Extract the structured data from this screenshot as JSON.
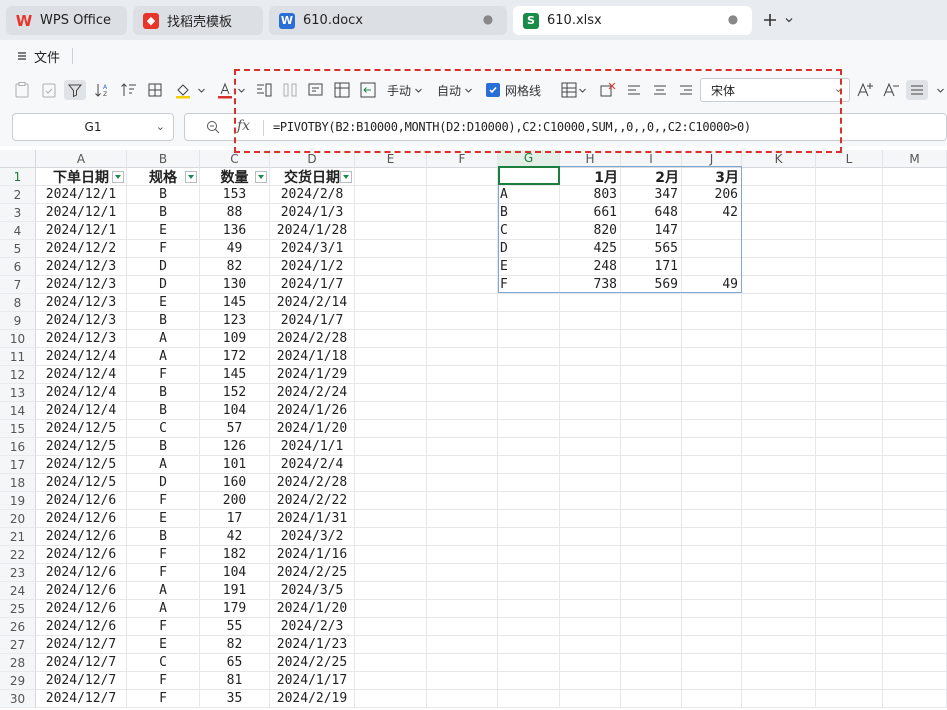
{
  "tabs": [
    {
      "label": "WPS Office",
      "icon": "wps-logo-icon",
      "color": "#e8352c"
    },
    {
      "label": "找稻壳模板",
      "icon": "docer-icon",
      "color": "#e8352c"
    },
    {
      "label": "610.docx",
      "icon": "word-doc-icon",
      "color": "#2b6fd6"
    },
    {
      "label": "610.xlsx",
      "icon": "spreadsheet-icon",
      "color": "#1a8a48"
    }
  ],
  "menu": {
    "file_label": "文件"
  },
  "toolbar": {
    "manual_label": "手动",
    "auto_label": "自动",
    "gridlines_label": "网格线",
    "gridlines_checked": true,
    "font_name": "宋体",
    "font_color": "#d9302c"
  },
  "formula_bar": {
    "cell_ref": "G1",
    "formula": "=PIVOTBY(B2:B10000,MONTH(D2:D10000),C2:C10000,SUM,,0,,0,,C2:C10000>0)"
  },
  "sheet": {
    "columns": [
      "A",
      "B",
      "C",
      "D",
      "E",
      "F",
      "G",
      "H",
      "I",
      "J",
      "K",
      "L",
      "M"
    ],
    "selected_column": "G",
    "selected_row": "1",
    "row_numbers": [
      "1",
      "2",
      "3",
      "4",
      "5",
      "6",
      "7",
      "8",
      "9",
      "10",
      "11",
      "12",
      "13",
      "14",
      "15",
      "16",
      "17",
      "18",
      "19",
      "20",
      "21",
      "22",
      "23",
      "24",
      "25",
      "26",
      "27",
      "28",
      "29",
      "30"
    ],
    "headers": {
      "a": "下单日期",
      "b": "规格",
      "c": "数量",
      "d": "交货日期"
    },
    "rows": [
      [
        "2024/12/1",
        "B",
        "153",
        "2024/2/8"
      ],
      [
        "2024/12/1",
        "B",
        "88",
        "2024/1/3"
      ],
      [
        "2024/12/1",
        "E",
        "136",
        "2024/1/28"
      ],
      [
        "2024/12/2",
        "F",
        "49",
        "2024/3/1"
      ],
      [
        "2024/12/3",
        "D",
        "82",
        "2024/1/2"
      ],
      [
        "2024/12/3",
        "D",
        "130",
        "2024/1/7"
      ],
      [
        "2024/12/3",
        "E",
        "145",
        "2024/2/14"
      ],
      [
        "2024/12/3",
        "B",
        "123",
        "2024/1/7"
      ],
      [
        "2024/12/3",
        "A",
        "109",
        "2024/2/28"
      ],
      [
        "2024/12/4",
        "A",
        "172",
        "2024/1/18"
      ],
      [
        "2024/12/4",
        "F",
        "145",
        "2024/1/29"
      ],
      [
        "2024/12/4",
        "B",
        "152",
        "2024/2/24"
      ],
      [
        "2024/12/4",
        "B",
        "104",
        "2024/1/26"
      ],
      [
        "2024/12/5",
        "C",
        "57",
        "2024/1/20"
      ],
      [
        "2024/12/5",
        "B",
        "126",
        "2024/1/1"
      ],
      [
        "2024/12/5",
        "A",
        "101",
        "2024/2/4"
      ],
      [
        "2024/12/5",
        "D",
        "160",
        "2024/2/28"
      ],
      [
        "2024/12/6",
        "F",
        "200",
        "2024/2/22"
      ],
      [
        "2024/12/6",
        "E",
        "17",
        "2024/1/31"
      ],
      [
        "2024/12/6",
        "B",
        "42",
        "2024/3/2"
      ],
      [
        "2024/12/6",
        "F",
        "182",
        "2024/1/16"
      ],
      [
        "2024/12/6",
        "F",
        "104",
        "2024/2/25"
      ],
      [
        "2024/12/6",
        "A",
        "191",
        "2024/3/5"
      ],
      [
        "2024/12/6",
        "A",
        "179",
        "2024/1/20"
      ],
      [
        "2024/12/6",
        "F",
        "55",
        "2024/2/3"
      ],
      [
        "2024/12/7",
        "E",
        "82",
        "2024/1/23"
      ],
      [
        "2024/12/7",
        "C",
        "65",
        "2024/2/25"
      ],
      [
        "2024/12/7",
        "F",
        "81",
        "2024/1/17"
      ],
      [
        "2024/12/7",
        "F",
        "35",
        "2024/2/19"
      ]
    ],
    "pivot": {
      "header": [
        "",
        "1月",
        "2月",
        "3月"
      ],
      "rows": [
        [
          "A",
          "803",
          "347",
          "206"
        ],
        [
          "B",
          "661",
          "648",
          "42"
        ],
        [
          "C",
          "820",
          "147",
          ""
        ],
        [
          "D",
          "425",
          "565",
          ""
        ],
        [
          "E",
          "248",
          "171",
          ""
        ],
        [
          "F",
          "738",
          "569",
          "49"
        ]
      ]
    }
  }
}
